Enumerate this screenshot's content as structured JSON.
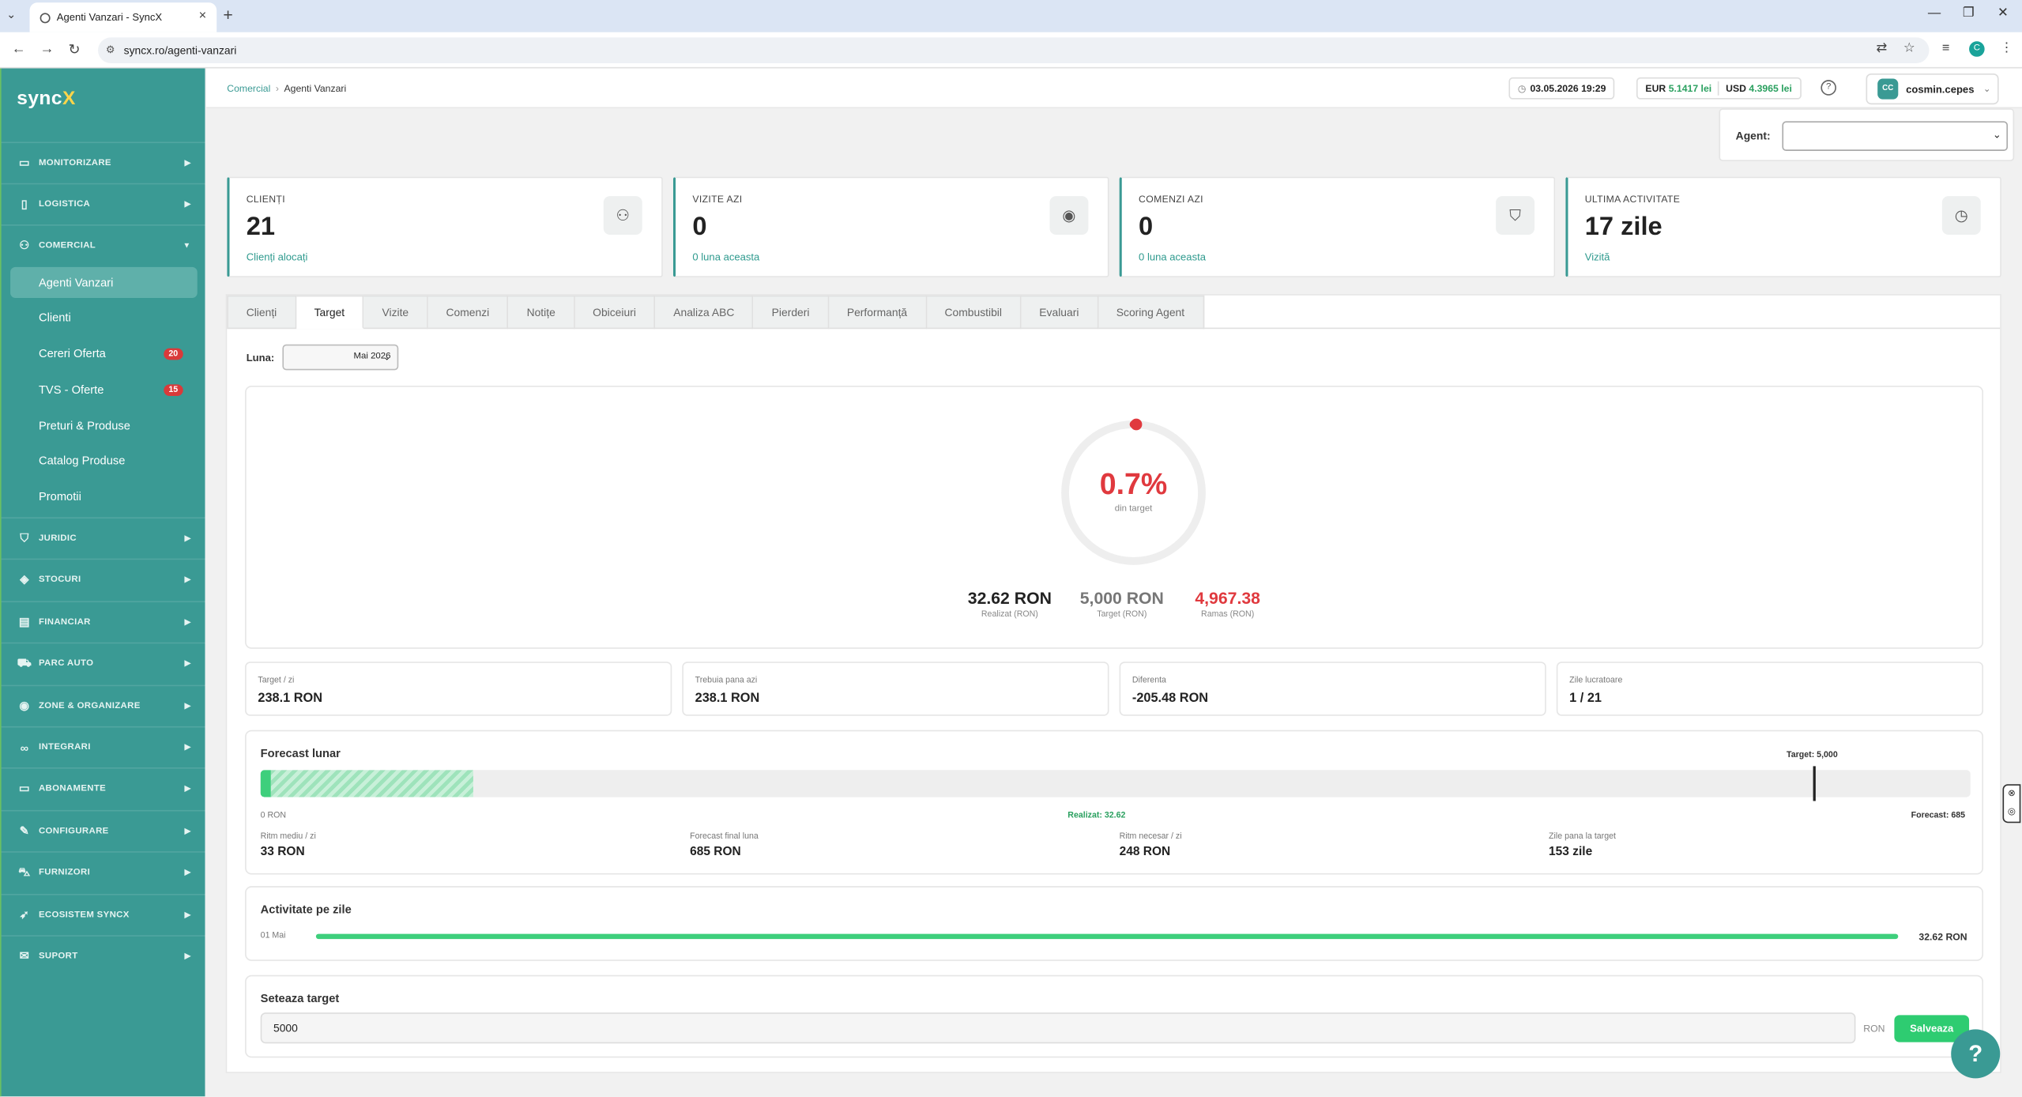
{
  "browser": {
    "tab_title": "Agenti Vanzari - SyncX",
    "url": "syncx.ro/agenti-vanzari",
    "profile_initial": "C"
  },
  "sidebar": {
    "logo_main": "sync",
    "logo_accent": "X",
    "sections": [
      {
        "label": "MONITORIZARE",
        "icon": "monitor-icon"
      },
      {
        "label": "LOGISTICA",
        "icon": "clipboard-icon"
      },
      {
        "label": "COMERCIAL",
        "icon": "users-icon",
        "expanded": true
      },
      {
        "label": "JURIDIC",
        "icon": "shield-icon"
      },
      {
        "label": "STOCURI",
        "icon": "layers-icon"
      },
      {
        "label": "FINANCIAR",
        "icon": "document-icon"
      },
      {
        "label": "PARC AUTO",
        "icon": "truck-icon"
      },
      {
        "label": "ZONE & ORGANIZARE",
        "icon": "location-icon"
      },
      {
        "label": "INTEGRARI",
        "icon": "link-icon"
      },
      {
        "label": "ABONAMENTE",
        "icon": "card-icon"
      },
      {
        "label": "CONFIGURARE",
        "icon": "wrench-icon"
      },
      {
        "label": "FURNIZORI",
        "icon": "cart-icon"
      },
      {
        "label": "ECOSISTEM SYNCX",
        "icon": "rocket-icon"
      },
      {
        "label": "SUPORT",
        "icon": "mail-icon"
      }
    ],
    "comercial_items": [
      {
        "label": "Agenti Vanzari",
        "active": true
      },
      {
        "label": "Clienti"
      },
      {
        "label": "Cereri Oferta",
        "badge": "20"
      },
      {
        "label": "TVS - Oferte",
        "badge": "15"
      },
      {
        "label": "Preturi & Produse"
      },
      {
        "label": "Catalog Produse"
      },
      {
        "label": "Promotii"
      }
    ]
  },
  "topbar": {
    "breadcrumb_parent": "Comercial",
    "breadcrumb_current": "Agenti Vanzari",
    "datetime": "03.05.2026 19:29",
    "eur_label": "EUR",
    "eur_value": "5.1417 lei",
    "usd_label": "USD",
    "usd_value": "4.3965 lei",
    "user_initials": "CC",
    "user_name": "cosmin.cepes"
  },
  "agent_filter": {
    "label": "Agent:",
    "value": ""
  },
  "stats": [
    {
      "label": "CLIENȚI",
      "value": "21",
      "sub": "Clienți alocați",
      "icon": "users-icon"
    },
    {
      "label": "VIZITE AZI",
      "value": "0",
      "sub": "0 luna aceasta",
      "icon": "location-pin-icon"
    },
    {
      "label": "COMENZI AZI",
      "value": "0",
      "sub": "0 luna aceasta",
      "icon": "shopping-bag-icon"
    },
    {
      "label": "ULTIMA ACTIVITATE",
      "value": "17 zile",
      "sub": "Vizită",
      "icon": "clock-icon"
    }
  ],
  "tabs": [
    "Clienți",
    "Target",
    "Vizite",
    "Comenzi",
    "Notițe",
    "Obiceiuri",
    "Analiza ABC",
    "Pierderi",
    "Performanță",
    "Combustibil",
    "Evaluari",
    "Scoring Agent"
  ],
  "active_tab": "Target",
  "target": {
    "month_label": "Luna:",
    "month_value": "Mai 2026",
    "percent": "0.7%",
    "percent_value": 0.0065,
    "percent_sub": "din target",
    "realizat": "32.62 RON",
    "realizat_label": "Realizat (RON)",
    "target": "5,000 RON",
    "target_label": "Target (RON)",
    "ramas": "4,967.38",
    "ramas_label": "Ramas (RON)"
  },
  "metrics": [
    {
      "label": "Target / zi",
      "value": "238.1 RON",
      "color": "#222222"
    },
    {
      "label": "Trebuia pana azi",
      "value": "238.1 RON",
      "color": "#222222"
    },
    {
      "label": "Diferenta",
      "value": "-205.48 RON",
      "color": "#e0393e"
    },
    {
      "label": "Zile lucratoare",
      "value": "1 / 21",
      "color": "#222222"
    }
  ],
  "forecast": {
    "title": "Forecast lunar",
    "target_marker": "Target: 5,000",
    "start_label": "0 RON",
    "realizat_marker": "Realizat: 32.62",
    "forecast_marker": "Forecast: 685",
    "realizat_value": 32.62,
    "forecast_value": 685,
    "target_value": 5000,
    "scale_max": 5500,
    "items": [
      {
        "label": "Ritm mediu / zi",
        "value": "33 RON",
        "color": "#222222"
      },
      {
        "label": "Forecast final luna",
        "value": "685 RON",
        "color": "#e0393e"
      },
      {
        "label": "Ritm necesar / zi",
        "value": "248 RON",
        "color": "#2f80d1"
      },
      {
        "label": "Zile pana la target",
        "value": "153 zile",
        "color": "#222222"
      }
    ]
  },
  "activity": {
    "title": "Activitate pe zile",
    "day_label": "01 Mai",
    "day_value": "32.62 RON"
  },
  "set_target": {
    "title": "Seteaza target",
    "value": "5000",
    "unit": "RON",
    "save_label": "Salveaza"
  },
  "help_fab": "?"
}
